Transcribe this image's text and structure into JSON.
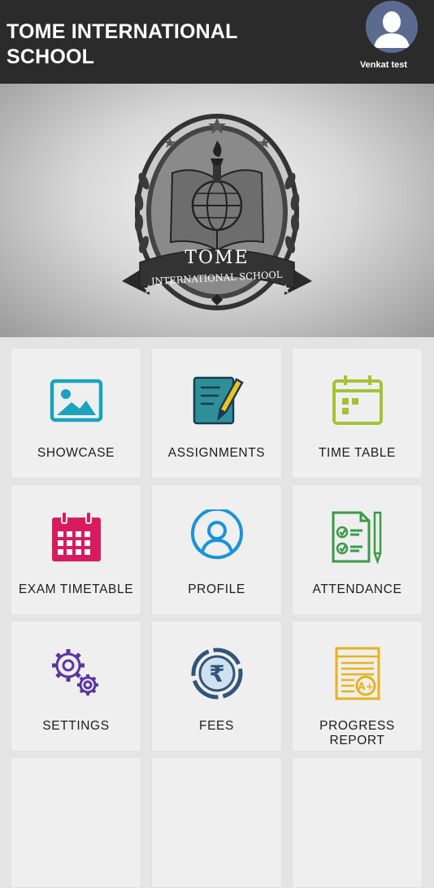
{
  "header": {
    "title": "TOME INTERNATIONAL SCHOOL",
    "user_name": "Venkat test"
  },
  "banner": {
    "logo_name": "TOME",
    "logo_subtitle": "INTERNATIONAL SCHOOL"
  },
  "menu": {
    "items": [
      {
        "label": "SHOWCASE",
        "icon": "image-icon",
        "color": "#1aa3bd"
      },
      {
        "label": "ASSIGNMENTS",
        "icon": "notepad-pencil-icon",
        "color": "#2e8f99"
      },
      {
        "label": "TIME TABLE",
        "icon": "calendar-icon",
        "color": "#a6c235"
      },
      {
        "label": "EXAM TIMETABLE",
        "icon": "calendar-grid-icon",
        "color": "#d81b5f"
      },
      {
        "label": "PROFILE",
        "icon": "user-circle-icon",
        "color": "#1a93d8"
      },
      {
        "label": "ATTENDANCE",
        "icon": "checklist-icon",
        "color": "#3c9a48"
      },
      {
        "label": "SETTINGS",
        "icon": "gears-icon",
        "color": "#5a35a4"
      },
      {
        "label": "FEES",
        "icon": "rupee-coin-icon",
        "color": "#31557a"
      },
      {
        "label": "PROGRESS REPORT",
        "icon": "report-icon",
        "color": "#e8b21c"
      }
    ]
  }
}
